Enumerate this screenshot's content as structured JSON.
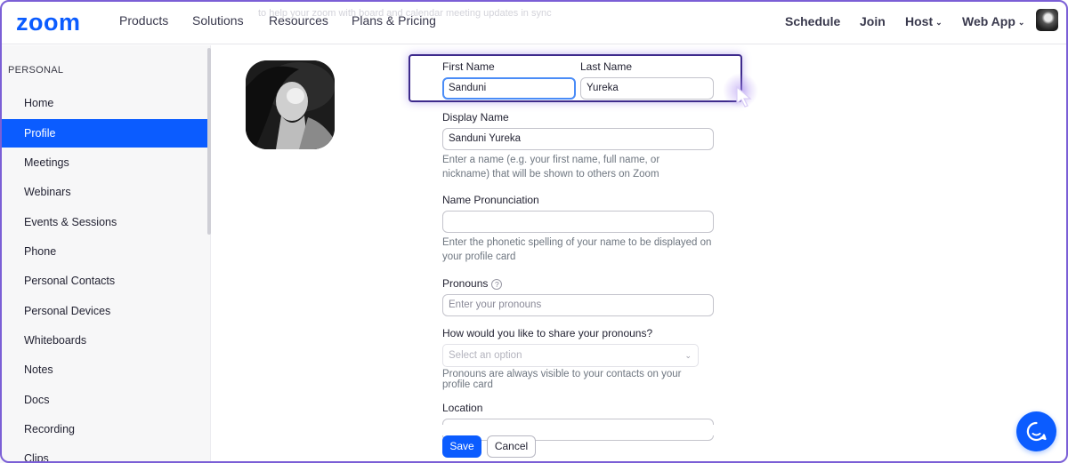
{
  "nav": {
    "logo": "zoom",
    "items": [
      "Products",
      "Solutions",
      "Resources",
      "Plans & Pricing"
    ],
    "right": {
      "schedule": "Schedule",
      "join": "Join",
      "host": "Host",
      "webapp": "Web App"
    },
    "ghost_text": "to help your zoom with board and calendar meeting updates in sync"
  },
  "sidebar": {
    "heading": "PERSONAL",
    "items": [
      {
        "label": "Home"
      },
      {
        "label": "Profile",
        "active": true
      },
      {
        "label": "Meetings"
      },
      {
        "label": "Webinars"
      },
      {
        "label": "Events & Sessions"
      },
      {
        "label": "Phone"
      },
      {
        "label": "Personal Contacts"
      },
      {
        "label": "Personal Devices"
      },
      {
        "label": "Whiteboards"
      },
      {
        "label": "Notes"
      },
      {
        "label": "Docs"
      },
      {
        "label": "Recording"
      },
      {
        "label": "Clips"
      }
    ]
  },
  "form": {
    "first_name_label": "First Name",
    "first_name_value": "Sanduni",
    "last_name_label": "Last Name",
    "last_name_value": "Yureka",
    "display_name_label": "Display Name",
    "display_name_value": "Sanduni Yureka",
    "display_name_help": "Enter a name (e.g. your first name, full name, or nickname) that will be shown to others on Zoom",
    "pronunciation_label": "Name Pronunciation",
    "pronunciation_value": "",
    "pronunciation_help": "Enter the phonetic spelling of your name to be displayed on your profile card",
    "pronouns_label": "Pronouns",
    "pronouns_placeholder": "Enter your pronouns",
    "share_pronouns_label": "How would you like to share your pronouns?",
    "share_pronouns_placeholder": "Select an option",
    "share_pronouns_help": "Pronouns are always visible to your contacts on your profile card",
    "location_label": "Location",
    "save": "Save",
    "cancel": "Cancel"
  },
  "colors": {
    "brand": "#0b5cff",
    "highlight": "#3d2a8c",
    "frame": "#7b5fd6"
  },
  "icons": [
    "chevron-down-icon",
    "help-icon",
    "chat-icon",
    "cursor-icon"
  ]
}
